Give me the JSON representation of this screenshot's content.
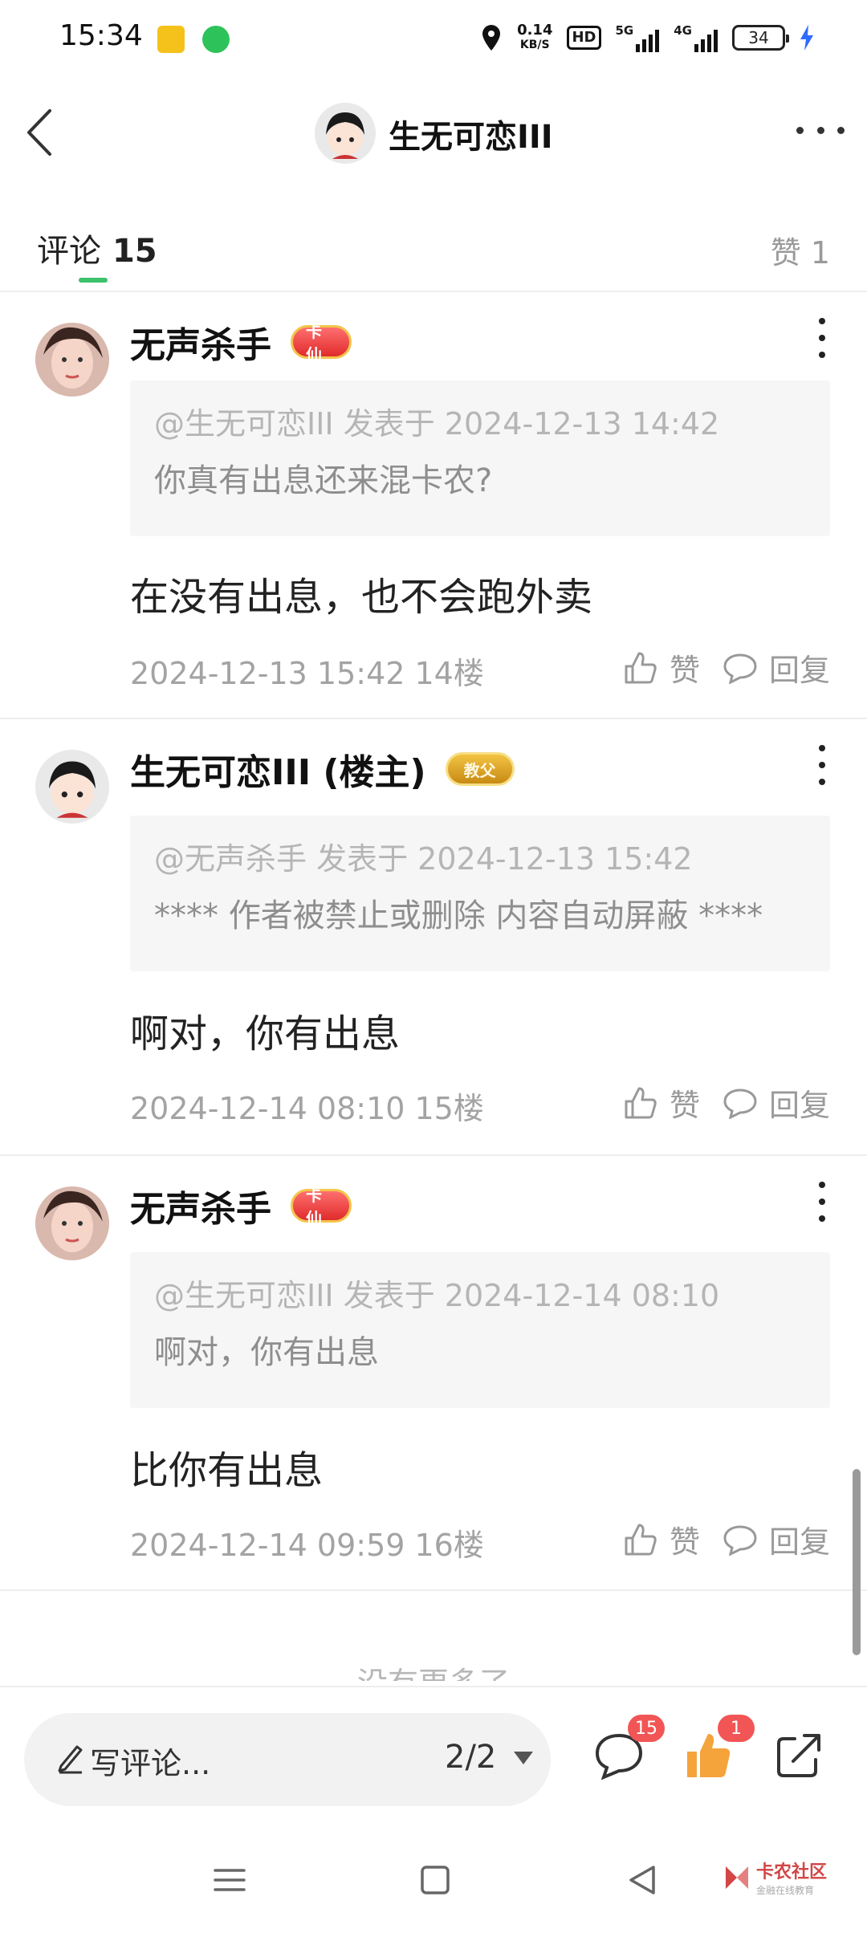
{
  "status_bar": {
    "time": "15:34",
    "net_speed_value": "0.14",
    "net_speed_unit": "KB/S",
    "hd_label": "HD",
    "signal1_label": "5G",
    "signal2_label": "4G",
    "battery": "34"
  },
  "header": {
    "title": "生无可恋III"
  },
  "tabs": {
    "comments_label": "评论",
    "comments_count": "15",
    "likes_label": "赞 1"
  },
  "comments": [
    {
      "name": "无声杀手",
      "badge": "卡仙",
      "quote_meta": "@生无可恋III 发表于 2024-12-13 14:42",
      "quote_text": "你真有出息还来混卡农?",
      "text": "在没有出息，也不会跑外卖",
      "meta": "2024-12-13 15:42  14楼",
      "like_label": "赞",
      "reply_label": "回复"
    },
    {
      "name": "生无可恋III (楼主)",
      "badge": "教父",
      "quote_meta": "@无声杀手 发表于 2024-12-13 15:42",
      "quote_text": "**** 作者被禁止或删除 内容自动屏蔽 ****",
      "text": "啊对，你有出息",
      "meta": "2024-12-14 08:10  15楼",
      "like_label": "赞",
      "reply_label": "回复"
    },
    {
      "name": "无声杀手",
      "badge": "卡仙",
      "quote_meta": "@生无可恋III 发表于 2024-12-14 08:10",
      "quote_text": "啊对，你有出息",
      "text": "比你有出息",
      "meta": "2024-12-14 09:59  16楼",
      "like_label": "赞",
      "reply_label": "回复"
    }
  ],
  "no_more_text": "没有更多了",
  "bottom_bar": {
    "write_placeholder": "写评论...",
    "page_indicator": "2/2",
    "comment_count": "15",
    "like_count": "1"
  },
  "watermark": {
    "title": "卡农社区",
    "subtitle": "金融在线教育"
  },
  "colors": {
    "accent_green": "#3bc26b",
    "badge_red": "#f25555",
    "like_orange": "#f5a33b"
  }
}
